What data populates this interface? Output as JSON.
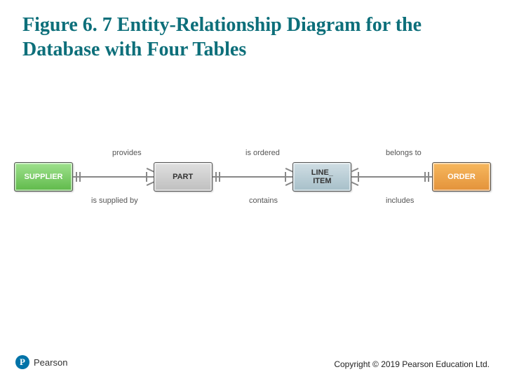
{
  "title": "Figure 6. 7 Entity-Relationship Diagram for the Database with Four Tables",
  "entities": {
    "supplier": "SUPPLIER",
    "part": "PART",
    "line_item": "LINE_\nITEM",
    "order": "ORDER"
  },
  "relationships": {
    "supplier_part_top": "provides",
    "supplier_part_bottom": "is supplied by",
    "part_lineitem_top": "is ordered",
    "part_lineitem_bottom": "contains",
    "lineitem_order_top": "belongs to",
    "lineitem_order_bottom": "includes"
  },
  "footer": {
    "brand_glyph": "P",
    "brand_name": "Pearson",
    "copyright": "Copyright © 2019 Pearson Education Ltd."
  }
}
